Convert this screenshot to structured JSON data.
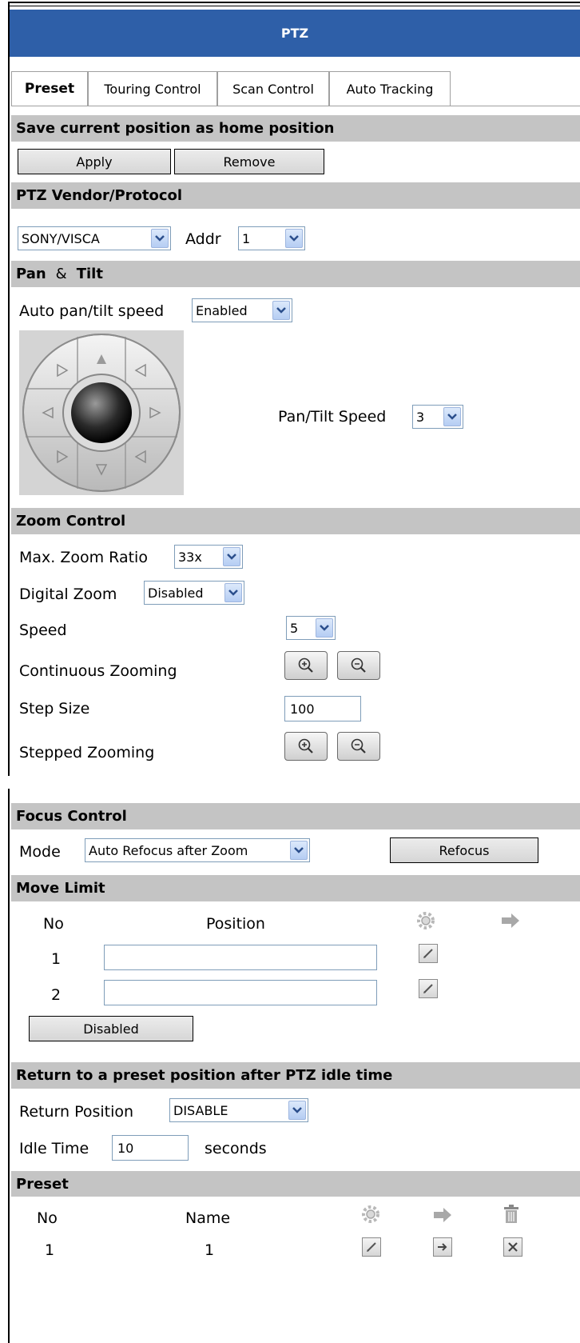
{
  "title": "PTZ",
  "tabs": [
    {
      "label": "Preset"
    },
    {
      "label": "Touring Control"
    },
    {
      "label": "Scan Control"
    },
    {
      "label": "Auto Tracking"
    }
  ],
  "home_section": {
    "title": "Save current position as home position",
    "apply_label": "Apply",
    "remove_label": "Remove"
  },
  "vendor_section": {
    "title": "PTZ Vendor/Protocol",
    "protocol_value": "SONY/VISCA",
    "addr_label": "Addr",
    "addr_value": "1"
  },
  "pantilt_section": {
    "title": "Pan",
    "title_amp": "&",
    "title_tilt": "Tilt",
    "auto_speed_label": "Auto pan/tilt speed",
    "auto_speed_value": "Enabled",
    "speed_label": "Pan/Tilt Speed",
    "speed_value": "3"
  },
  "zoom_section": {
    "title": "Zoom Control",
    "max_ratio_label": "Max. Zoom Ratio",
    "max_ratio_value": "33x",
    "digital_label": "Digital Zoom",
    "digital_value": "Disabled",
    "speed_label": "Speed",
    "speed_value": "5",
    "continuous_label": "Continuous Zooming",
    "step_size_label": "Step Size",
    "step_size_value": "100",
    "stepped_label": "Stepped Zooming"
  },
  "focus_section": {
    "title": "Focus Control",
    "mode_label": "Mode",
    "mode_value": "Auto Refocus after Zoom",
    "refocus_label": "Refocus"
  },
  "move_limit": {
    "title": "Move Limit",
    "col_no": "No",
    "col_position": "Position",
    "rows": [
      {
        "no": "1",
        "position": ""
      },
      {
        "no": "2",
        "position": ""
      }
    ],
    "disabled_label": "Disabled"
  },
  "return_section": {
    "title": "Return to a preset position after PTZ idle time",
    "position_label": "Return Position",
    "position_value": "DISABLE",
    "idle_label": "Idle Time",
    "idle_value": "10",
    "idle_unit": "seconds"
  },
  "preset_section": {
    "title": "Preset",
    "col_no": "No",
    "col_name": "Name",
    "rows": [
      {
        "no": "1",
        "name": "1"
      }
    ]
  },
  "colors": {
    "title_bar": "#2e5fa8",
    "section_bg": "#c4c4c4",
    "select_border": "#7f9db9"
  }
}
